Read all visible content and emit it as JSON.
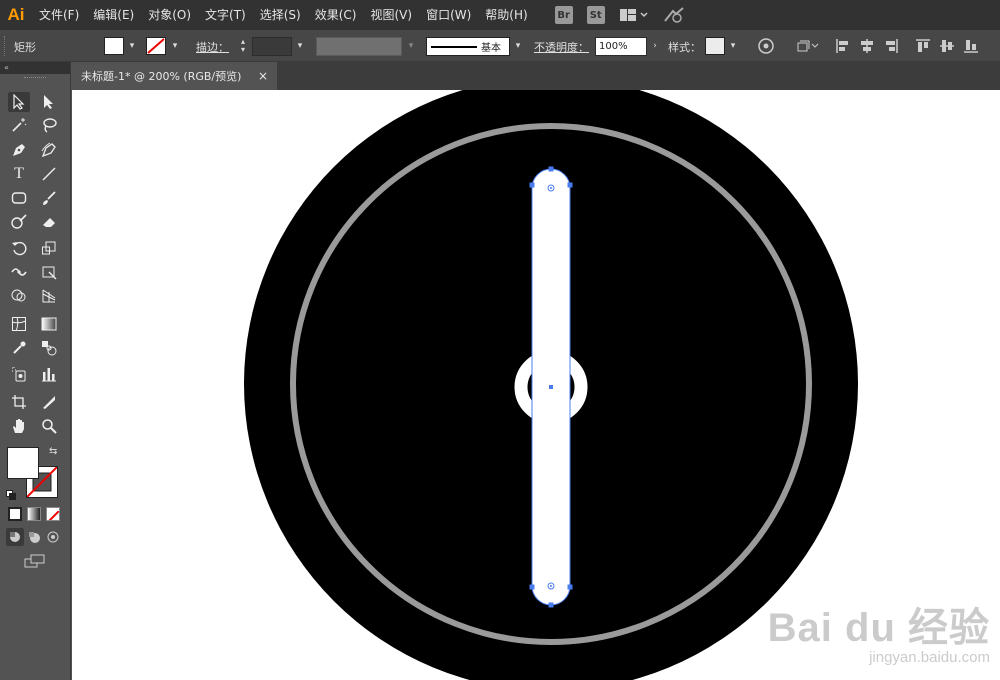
{
  "app": {
    "logo": "Ai"
  },
  "menubar": {
    "items": [
      "文件(F)",
      "编辑(E)",
      "对象(O)",
      "文字(T)",
      "选择(S)",
      "效果(C)",
      "视图(V)",
      "窗口(W)",
      "帮助(H)"
    ],
    "bridge": "Br",
    "stock": "St"
  },
  "controlbar": {
    "object_type": "矩形",
    "fill_color": "#ffffff",
    "stroke_none": true,
    "stroke_label": "描边：",
    "stroke_style": "基本",
    "opacity_label": "不透明度：",
    "opacity_value": "100%",
    "style_label": "样式："
  },
  "document": {
    "tab_title": "未标题-1* @ 200% (RGB/预览)",
    "close": "×"
  },
  "artwork": {
    "outer_circle_color": "#000000",
    "ring_color": "#9a9a9a",
    "inner_disc_color": "#000000",
    "center_ring_color": "#ffffff",
    "bar_color": "#ffffff",
    "selection_color": "#4a7cf0"
  },
  "watermark": {
    "main": "Bai du 经验",
    "sub": "jingyan.baidu.com"
  }
}
